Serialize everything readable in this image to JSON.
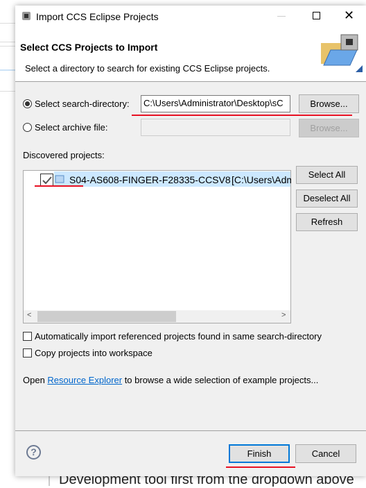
{
  "window": {
    "title": "Import CCS Eclipse Projects"
  },
  "header": {
    "title": "Select CCS Projects to Import",
    "subtitle": "Select a directory to search for existing CCS Eclipse projects."
  },
  "search_dir": {
    "label": "Select search-directory:",
    "value": "C:\\Users\\Administrator\\Desktop\\sC",
    "browse": "Browse...",
    "selected": true
  },
  "archive": {
    "label": "Select archive file:",
    "value": "",
    "browse": "Browse...",
    "selected": false
  },
  "projects": {
    "label": "Discovered projects:",
    "items": [
      {
        "name": "S04-AS608-FINGER-F28335-CCSV8",
        "path": "[C:\\Users\\Adm",
        "checked": true
      }
    ]
  },
  "side_buttons": {
    "select_all": "Select All",
    "deselect_all": "Deselect All",
    "refresh": "Refresh"
  },
  "options": [
    {
      "label": "Automatically import referenced projects found in same search-directory",
      "checked": false
    },
    {
      "label": "Copy projects into workspace",
      "checked": false
    }
  ],
  "link_line": {
    "prefix": "Open ",
    "link": "Resource Explorer",
    "suffix": " to browse a wide selection of example projects..."
  },
  "footer": {
    "finish": "Finish",
    "cancel": "Cancel"
  },
  "background_text": "Development tool first from the dropdown above",
  "colors": {
    "accent": "#0078d7",
    "annotation": "#e81123",
    "link": "#0066cc"
  }
}
